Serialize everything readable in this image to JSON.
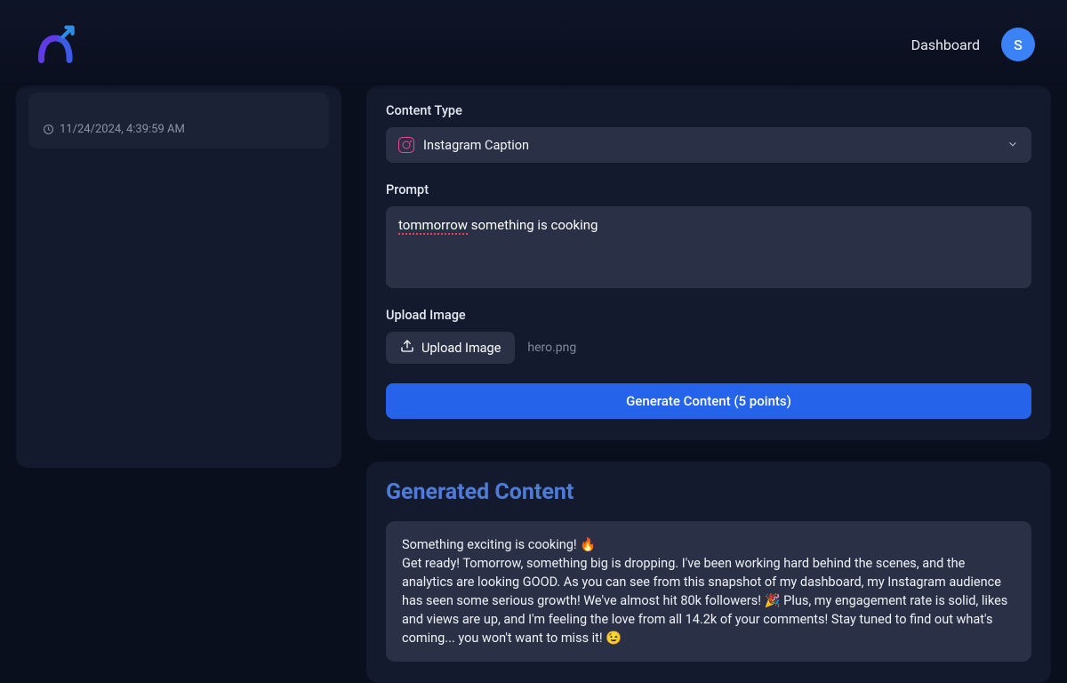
{
  "header": {
    "dashboard_label": "Dashboard",
    "avatar_initial": "S"
  },
  "history": {
    "timestamp": "11/24/2024, 4:39:59 AM"
  },
  "form": {
    "content_type_label": "Content Type",
    "content_type_value": "Instagram Caption",
    "prompt_label": "Prompt",
    "prompt_misspelled": "tommorrow",
    "prompt_rest": " something is cooking",
    "upload_label": "Upload Image",
    "upload_button": "Upload Image",
    "upload_filename": "hero.png",
    "generate_button": "Generate Content (5 points)"
  },
  "generated": {
    "title": "Generated Content",
    "body": "Something exciting is cooking! 🔥\nGet ready! Tomorrow, something big is dropping. I've been working hard behind the scenes, and the analytics are looking GOOD. As you can see from this snapshot of my dashboard, my Instagram audience has seen some serious growth! We've almost hit 80k followers! 🎉  Plus, my engagement rate is solid, likes and views are up, and I'm feeling the love from all 14.2k of your comments! Stay tuned to find out what's coming... you won't want to miss it! 😉"
  }
}
